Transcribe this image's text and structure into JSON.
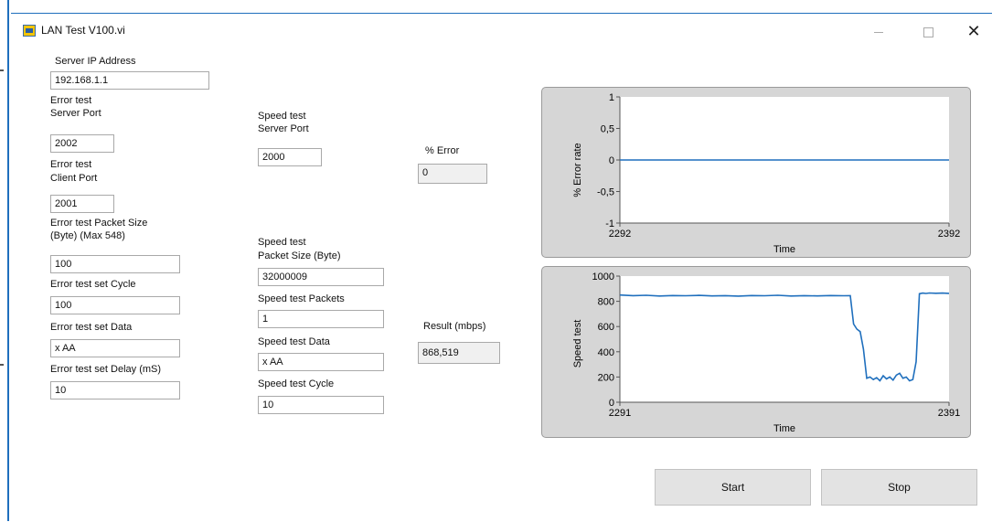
{
  "window": {
    "title": "LAN Test V100.vi",
    "icon": "labview-vi-icon",
    "controls": {
      "minimize": "minimize-icon",
      "maximize": "maximize-icon",
      "close": "close-icon"
    }
  },
  "server": {
    "ip_label": "Server IP Address",
    "ip_value": "192.168.1.1"
  },
  "error_test": {
    "server_port_label_1": "Error test",
    "server_port_label_2": "Server Port",
    "server_port_value": "2002",
    "client_port_label_1": "Error test",
    "client_port_label_2": "Client Port",
    "client_port_value": "2001",
    "packet_size_label_1": "Error test Packet Size",
    "packet_size_label_2": "(Byte) (Max 548)",
    "packet_size_value": "100",
    "cycle_label": "Error test set Cycle",
    "cycle_value": "100",
    "data_label": "Error test set Data",
    "data_value": "x AA",
    "delay_label": "Error test set Delay (mS)",
    "delay_value": "10"
  },
  "speed_test": {
    "server_port_label_1": "Speed test",
    "server_port_label_2": "Server Port",
    "server_port_value": "2000",
    "packet_size_label_1": "Speed test",
    "packet_size_label_2": "Packet Size (Byte)",
    "packet_size_value": "32000009",
    "packets_label": "Speed test Packets",
    "packets_value": "1",
    "data_label": "Speed test Data",
    "data_value": "x AA",
    "cycle_label": "Speed test Cycle",
    "cycle_value": "10"
  },
  "indicators": {
    "error_label": "% Error",
    "error_value": "0",
    "result_label": "Result (mbps)",
    "result_value": "868,519"
  },
  "buttons": {
    "start": "Start",
    "stop": "Stop"
  },
  "chart_data": [
    {
      "type": "line",
      "title": "",
      "xlabel": "Time",
      "ylabel": "% Error rate",
      "xlim": [
        2292,
        2392
      ],
      "ylim": [
        -1,
        1
      ],
      "x_ticks": [
        "2292",
        "2392"
      ],
      "y_ticks": [
        "1",
        "0,5",
        "0",
        "-0,5",
        "-1"
      ],
      "y_tick_values": [
        1,
        0.5,
        0,
        -0.5,
        -1
      ],
      "series": [
        {
          "x": [
            2292,
            2392
          ],
          "values": [
            0,
            0
          ]
        }
      ],
      "line_color": "#1f6fbd",
      "grid": false
    },
    {
      "type": "line",
      "title": "",
      "xlabel": "Time",
      "ylabel": "Speed test",
      "xlim": [
        2291,
        2391
      ],
      "ylim": [
        0,
        1000
      ],
      "x_ticks": [
        "2291",
        "2391"
      ],
      "y_ticks": [
        "1000",
        "800",
        "600",
        "400",
        "200",
        "0"
      ],
      "y_tick_values": [
        1000,
        800,
        600,
        400,
        200,
        0
      ],
      "series": [
        {
          "x": [
            2291,
            2295,
            2299,
            2303,
            2307,
            2311,
            2315,
            2319,
            2323,
            2327,
            2331,
            2335,
            2339,
            2343,
            2347,
            2351,
            2355,
            2359,
            2361,
            2362,
            2363,
            2364,
            2365,
            2366,
            2367,
            2368,
            2369,
            2370,
            2371,
            2372,
            2373,
            2374,
            2375,
            2376,
            2377,
            2378,
            2379,
            2380,
            2381,
            2382,
            2383,
            2384,
            2385,
            2387,
            2389,
            2391
          ],
          "values": [
            850,
            845,
            848,
            842,
            846,
            844,
            847,
            843,
            845,
            841,
            846,
            844,
            848,
            842,
            845,
            843,
            846,
            844,
            845,
            620,
            580,
            560,
            420,
            190,
            200,
            180,
            195,
            170,
            210,
            185,
            200,
            175,
            215,
            230,
            190,
            200,
            170,
            180,
            320,
            860,
            865,
            862,
            866,
            864,
            865,
            863
          ]
        }
      ],
      "line_color": "#1f6fbd",
      "grid": false
    }
  ]
}
